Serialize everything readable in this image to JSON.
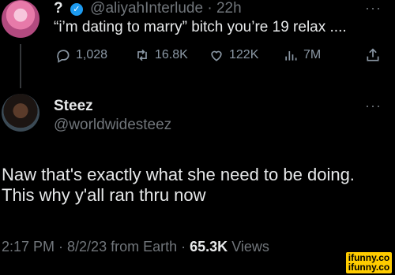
{
  "parent": {
    "name": "?",
    "handle": "@aliyahInterlude",
    "separator": "·",
    "time": "22h",
    "text": "“i’m dating to marry” bitch you’re 19 relax ....",
    "more": "···",
    "actions": {
      "replies": "1,028",
      "retweets": "16.8K",
      "likes": "122K",
      "views": "7M"
    }
  },
  "tweet": {
    "name": "Steez",
    "handle": "@worldwidesteez",
    "more": "···",
    "body_line1": "Naw that's exactly what she need to be doing.",
    "body_line2": "This why y'all ran thru now",
    "meta_time": "2:17 PM · 8/2/23 from Earth ·",
    "meta_views_count": "65.3K",
    "meta_views_label": "Views"
  },
  "watermark": {
    "line1": "ifunny.co",
    "line2": "ifunny.co"
  },
  "colors": {
    "background": "#000000",
    "text": "#e7e9ea",
    "muted": "#71767b",
    "verified": "#1d9bf0",
    "watermark": "#ffcc00"
  },
  "icons": [
    "reply-icon",
    "retweet-icon",
    "like-icon",
    "views-icon",
    "share-icon",
    "verified-badge-icon",
    "more-icon"
  ]
}
